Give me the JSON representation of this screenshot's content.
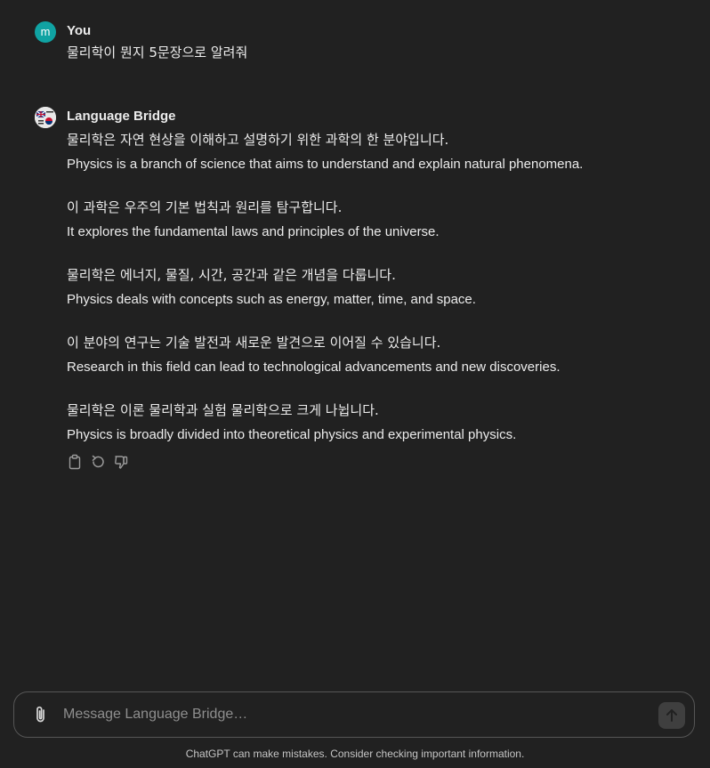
{
  "user_message": {
    "author": "You",
    "avatar_letter": "m",
    "text": "물리학이 뭔지 5문장으로 알려줘"
  },
  "assistant_message": {
    "author": "Language Bridge",
    "sentences": [
      {
        "ko": "물리학은 자연 현상을 이해하고 설명하기 위한 과학의 한 분야입니다.",
        "en": "Physics is a branch of science that aims to understand and explain natural phenomena."
      },
      {
        "ko": "이 과학은 우주의 기본 법칙과 원리를 탐구합니다.",
        "en": "It explores the fundamental laws and principles of the universe."
      },
      {
        "ko": "물리학은 에너지, 물질, 시간, 공간과 같은 개념을 다룹니다.",
        "en": "Physics deals with concepts such as energy, matter, time, and space."
      },
      {
        "ko": "이 분야의 연구는 기술 발전과 새로운 발견으로 이어질 수 있습니다.",
        "en": "Research in this field can lead to technological advancements and new discoveries."
      },
      {
        "ko": "물리학은 이론 물리학과 실험 물리학으로 크게 나뉩니다.",
        "en": "Physics is broadly divided into theoretical physics and experimental physics."
      }
    ],
    "actions": [
      "copy-icon",
      "regenerate-icon",
      "thumbs-down-icon"
    ]
  },
  "composer": {
    "placeholder": "Message Language Bridge…",
    "value": ""
  },
  "footer": {
    "disclaimer": "ChatGPT can make mistakes. Consider checking important information."
  },
  "colors": {
    "background": "#212121",
    "text": "#ececec",
    "user_avatar": "#10a3a3",
    "muted": "#8e8e8e"
  }
}
